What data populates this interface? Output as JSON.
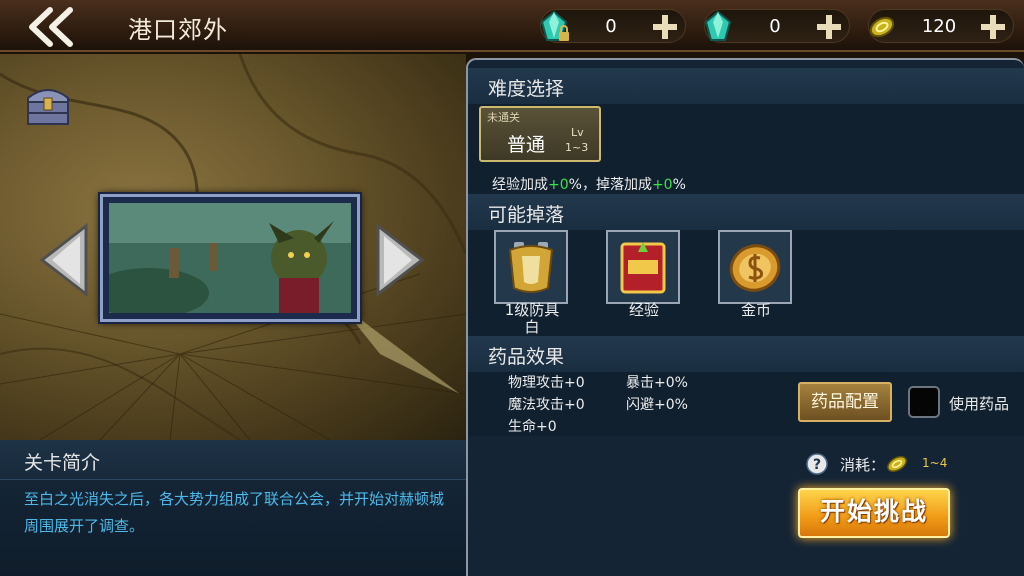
{
  "header": {
    "title": "港口郊外"
  },
  "resources": [
    {
      "icon": "locked-gem-icon",
      "value": "0"
    },
    {
      "icon": "gem-icon",
      "value": "0"
    },
    {
      "icon": "coin-icon",
      "value": "120"
    }
  ],
  "intro": {
    "title": "关卡简介",
    "text": "至白之光消失之后，各大势力组成了联合公会，并开始对赫顿城周围展开了调查。"
  },
  "difficulty": {
    "title": "难度选择",
    "button": {
      "status": "未通关",
      "label": "普通",
      "lv": "Lv",
      "range": "1~3"
    },
    "bonus": {
      "exp_label": "经验加成",
      "exp_value": "+0",
      "sep": "%，",
      "drop_label": "掉落加成",
      "drop_value": "+0",
      "end": "%"
    }
  },
  "drops": {
    "title": "可能掉落",
    "items": [
      {
        "icon": "armor-icon",
        "label_line1": "1级防具",
        "label_line2": "白"
      },
      {
        "icon": "exp-book-icon",
        "label_line1": "经验",
        "label_line2": ""
      },
      {
        "icon": "gold-coin-icon",
        "label_line1": "金币",
        "label_line2": ""
      }
    ]
  },
  "potion": {
    "title": "药品效果",
    "stats": [
      "物理攻击+0",
      "魔法攻击+0",
      "生命+0",
      "暴击+0%",
      "闪避+0%"
    ],
    "config_button": "药品配置",
    "use_label": "使用药品"
  },
  "cost": {
    "label": "消耗：",
    "value": "1~4"
  },
  "start_button": "开始挑战",
  "colors": {
    "accent_green": "#3ee04a",
    "intro_text": "#4fb8e8",
    "start_orange": "#f19a17"
  }
}
